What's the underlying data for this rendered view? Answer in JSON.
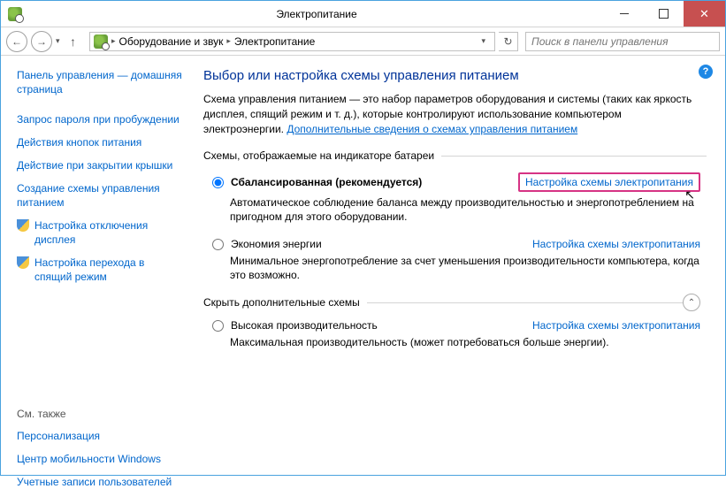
{
  "window": {
    "title": "Электропитание"
  },
  "nav": {
    "path1": "Оборудование и звук",
    "path2": "Электропитание",
    "search_placeholder": "Поиск в панели управления"
  },
  "sidebar": {
    "home": "Панель управления — домашняя страница",
    "items": [
      "Запрос пароля при пробуждении",
      "Действия кнопок питания",
      "Действие при закрытии крышки",
      "Создание схемы управления питанием",
      "Настройка отключения дисплея",
      "Настройка перехода в спящий режим"
    ],
    "see_also_label": "См. также",
    "see_also": [
      "Персонализация",
      "Центр мобильности Windows",
      "Учетные записи пользователей"
    ]
  },
  "main": {
    "heading": "Выбор или настройка схемы управления питанием",
    "desc": "Схема управления питанием — это набор параметров оборудования и системы (таких как яркость дисплея, спящий режим и т. д.), которые контролируют использование компьютером электроэнергии. ",
    "desc_link": "Дополнительные сведения о схемах управления питанием",
    "group1_label": "Схемы, отображаемые на индикаторе батареи",
    "group2_label": "Скрыть дополнительные схемы",
    "change_link": "Настройка схемы электропитания",
    "plans": [
      {
        "name": "Сбалансированная (рекомендуется)",
        "desc": "Автоматическое соблюдение баланса между производительностью и энергопотреблением на пригодном для этого оборудовании.",
        "checked": true
      },
      {
        "name": "Экономия энергии",
        "desc": "Минимальное энергопотребление за счет уменьшения производительности компьютера, когда это возможно.",
        "checked": false
      },
      {
        "name": "Высокая производительность",
        "desc": "Максимальная производительность (может потребоваться больше энергии).",
        "checked": false
      }
    ]
  }
}
